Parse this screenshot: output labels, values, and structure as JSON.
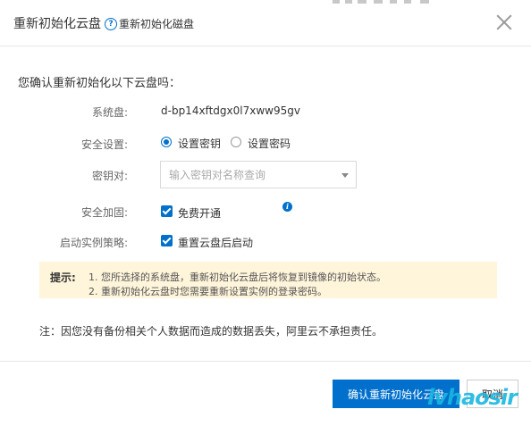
{
  "dialog": {
    "title": "重新初始化云盘",
    "help_link": "重新初始化磁盘",
    "question": "您确认重新初始化以下云盘吗：",
    "system_disk": {
      "label": "系统盘:",
      "value": "d-bp14xftdgx0l7xww95gv"
    },
    "security_setting": {
      "label": "安全设置:",
      "options": [
        "设置密钥",
        "设置密码"
      ],
      "selected": "设置密钥"
    },
    "key_pair": {
      "label": "密钥对:",
      "placeholder": "输入密钥对名称查询"
    },
    "security_hardening": {
      "label": "安全加固:",
      "checkbox_label": "免费开通",
      "checked": true
    },
    "start_policy": {
      "label": "启动实例策略:",
      "checkbox_label": "重置云盘后启动",
      "checked": true
    },
    "tip": {
      "label": "提示:",
      "lines": [
        "1. 您所选择的系统盘，重新初始化云盘后将恢复到镜像的初始状态。",
        "2. 重新初始化云盘时您需要重新设置实例的登录密码。"
      ]
    },
    "note": "注：因您没有备份相关个人数据而造成的数据丢失，阿里云不承担责任。",
    "confirm_button": "确认重新初始化云盘",
    "cancel_button": "取消",
    "watermark": "lvhaosir"
  },
  "colors": {
    "primary": "#0070cc",
    "tip_bg": "#fff5db",
    "watermark": "#19b8e0"
  },
  "icons": [
    "help-icon",
    "close-icon",
    "info-icon",
    "chevron-down-icon"
  ]
}
